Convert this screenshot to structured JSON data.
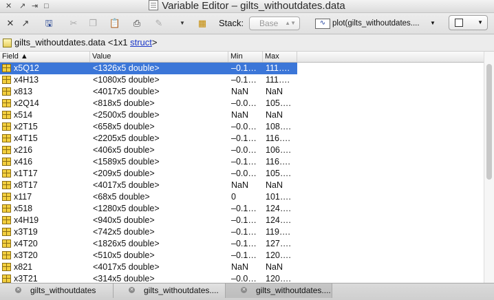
{
  "window": {
    "title": "Variable Editor – gilts_withoutdates.data"
  },
  "toolbar": {
    "stack_label": "Stack:",
    "stack_value": "Base",
    "plot_label": "plot(gilts_withoutdates...."
  },
  "variable": {
    "name": "gilts_withoutdates.data",
    "size": "<1x1",
    "class": "struct",
    "close": ">"
  },
  "table": {
    "headers": {
      "field": "Field ▲",
      "value": "Value",
      "min": "Min",
      "max": "Max"
    },
    "selected_index": 0,
    "rows": [
      {
        "field": "x5Q12",
        "value": "<1326x5 double>",
        "min": "–0.1…",
        "max": "111…."
      },
      {
        "field": "x4H13",
        "value": "<1080x5 double>",
        "min": "–0.1…",
        "max": "111…."
      },
      {
        "field": "x813",
        "value": "<4017x5 double>",
        "min": "NaN",
        "max": "NaN"
      },
      {
        "field": "x2Q14",
        "value": "<818x5 double>",
        "min": "–0.0…",
        "max": "105…."
      },
      {
        "field": "x514",
        "value": "<2500x5 double>",
        "min": "NaN",
        "max": "NaN"
      },
      {
        "field": "x2T15",
        "value": "<658x5 double>",
        "min": "–0.0…",
        "max": "108…."
      },
      {
        "field": "x4T15",
        "value": "<2205x5 double>",
        "min": "–0.1…",
        "max": "116…."
      },
      {
        "field": "x216",
        "value": "<406x5 double>",
        "min": "–0.0…",
        "max": "106…."
      },
      {
        "field": "x416",
        "value": "<1589x5 double>",
        "min": "–0.1…",
        "max": "116…."
      },
      {
        "field": "x1T17",
        "value": "<209x5 double>",
        "min": "–0.0…",
        "max": "105…."
      },
      {
        "field": "x8T17",
        "value": "<4017x5 double>",
        "min": "NaN",
        "max": "NaN"
      },
      {
        "field": "x117",
        "value": "<68x5 double>",
        "min": "0",
        "max": "101…."
      },
      {
        "field": "x518",
        "value": "<1280x5 double>",
        "min": "–0.1…",
        "max": "124…."
      },
      {
        "field": "x4H19",
        "value": "<940x5 double>",
        "min": "–0.1…",
        "max": "124…."
      },
      {
        "field": "x3T19",
        "value": "<742x5 double>",
        "min": "–0.1…",
        "max": "119…."
      },
      {
        "field": "x4T20",
        "value": "<1826x5 double>",
        "min": "–0.1…",
        "max": "127…."
      },
      {
        "field": "x3T20",
        "value": "<510x5 double>",
        "min": "–0.1…",
        "max": "120…."
      },
      {
        "field": "x821",
        "value": "<4017x5 double>",
        "min": "NaN",
        "max": "NaN"
      },
      {
        "field": "x3T21",
        "value": "<314x5 double>",
        "min": "–0.0…",
        "max": "120…."
      }
    ]
  },
  "tabs": [
    {
      "label": "gilts_withoutdates",
      "active": false
    },
    {
      "label": "gilts_withoutdates....",
      "active": false
    },
    {
      "label": "gilts_withoutdates....",
      "active": true
    }
  ]
}
